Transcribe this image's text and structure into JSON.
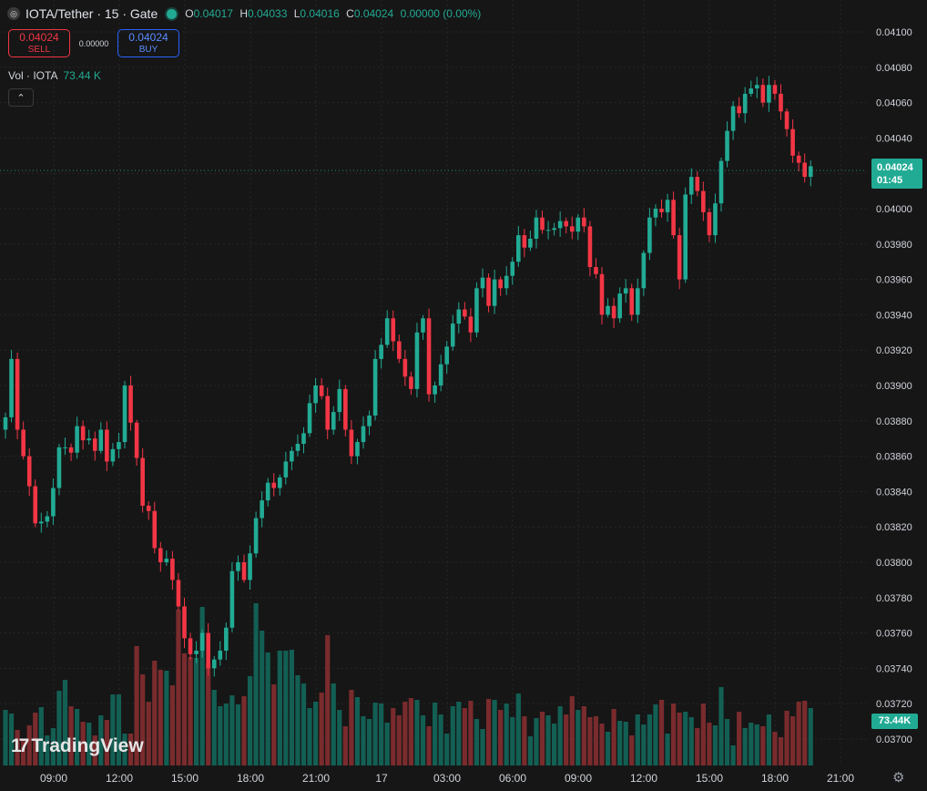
{
  "header": {
    "symbol_title": "IOTA/Tether · 15 · Gate",
    "logo_glyph": "◎",
    "ohlc": {
      "o_label": "O",
      "o": "0.04017",
      "h_label": "H",
      "h": "0.04033",
      "l_label": "L",
      "l": "0.04016",
      "c_label": "C",
      "c": "0.04024",
      "change": "0.00000 (0.00%)"
    }
  },
  "trade": {
    "sell_price": "0.04024",
    "sell_label": "SELL",
    "spread": "0.00000",
    "buy_price": "0.04024",
    "buy_label": "BUY"
  },
  "volume_legend": {
    "label": "Vol · IOTA",
    "value": "73.44 K"
  },
  "collapse_glyph": "⌃",
  "last_price": {
    "price": "0.04024",
    "countdown": "01:45"
  },
  "volume_tag": "73.44K",
  "brand": {
    "logo": "17",
    "name": "TradingView"
  },
  "settings_glyph": "⚙",
  "colors": {
    "up": "#22ab94",
    "down": "#f23645",
    "vol_up": "#135f54",
    "vol_down": "#7a2b2d",
    "background": "#161616"
  },
  "chart_data": {
    "type": "candlestick",
    "y_axis": {
      "min": 0.03695,
      "max": 0.04105,
      "ticks": [
        "0.04100",
        "0.04080",
        "0.04060",
        "0.04040",
        "0.04020",
        "0.04000",
        "0.03980",
        "0.03960",
        "0.03940",
        "0.03920",
        "0.03900",
        "0.03880",
        "0.03860",
        "0.03840",
        "0.03820",
        "0.03800",
        "0.03780",
        "0.03760",
        "0.03740",
        "0.03720",
        "0.03700"
      ]
    },
    "x_axis": {
      "labels": [
        "09:00",
        "12:00",
        "15:00",
        "18:00",
        "21:00",
        "17",
        "03:00",
        "06:00",
        "09:00",
        "12:00",
        "15:00",
        "18:00",
        "21:00"
      ]
    },
    "close": [
      0.03882,
      0.03915,
      0.03875,
      0.0386,
      0.03843,
      0.03822,
      0.03823,
      0.03826,
      0.03842,
      0.03865,
      0.03865,
      0.03862,
      0.03877,
      0.03869,
      0.0387,
      0.03863,
      0.03875,
      0.03857,
      0.03864,
      0.03868,
      0.039,
      0.03879,
      0.03859,
      0.03832,
      0.03829,
      0.03808,
      0.038,
      0.03802,
      0.0379,
      0.03775,
      0.03757,
      0.03748,
      0.0375,
      0.0376,
      0.0374,
      0.03745,
      0.0375,
      0.03763,
      0.03795,
      0.038,
      0.0379,
      0.03805,
      0.03825,
      0.03835,
      0.03845,
      0.03842,
      0.03848,
      0.03857,
      0.03863,
      0.03867,
      0.03873,
      0.0389,
      0.039,
      0.03894,
      0.03875,
      0.03885,
      0.03898,
      0.03875,
      0.0386,
      0.03868,
      0.03877,
      0.03883,
      0.03915,
      0.03923,
      0.03938,
      0.03925,
      0.03915,
      0.03905,
      0.03898,
      0.0393,
      0.03938,
      0.03895,
      0.039,
      0.03912,
      0.03922,
      0.03935,
      0.03943,
      0.03939,
      0.0393,
      0.03955,
      0.03961,
      0.03945,
      0.0396,
      0.03955,
      0.03962,
      0.0397,
      0.03985,
      0.03978,
      0.03983,
      0.03995,
      0.03988,
      0.03988,
      0.03989,
      0.03993,
      0.0399,
      0.03987,
      0.03995,
      0.0399,
      0.03967,
      0.03963,
      0.0394,
      0.03945,
      0.03938,
      0.03952,
      0.03955,
      0.0394,
      0.03955,
      0.03975,
      0.03995,
      0.04,
      0.03998,
      0.04005,
      0.03985,
      0.0396,
      0.04008,
      0.04018,
      0.0401,
      0.03998,
      0.03985,
      0.04003,
      0.04027,
      0.04044,
      0.04058,
      0.04054,
      0.04065,
      0.04068,
      0.0407,
      0.0406,
      0.0407,
      0.04065,
      0.04055,
      0.04045,
      0.0403,
      0.04026,
      0.04018,
      0.04024
    ],
    "volume": [
      61,
      57,
      39,
      27,
      44,
      58,
      64,
      33,
      41,
      82,
      94,
      65,
      62,
      48,
      47,
      33,
      55,
      50,
      78,
      78,
      35,
      35,
      131,
      100,
      70,
      115,
      105,
      104,
      88,
      171,
      123,
      119,
      118,
      174,
      111,
      83,
      65,
      68,
      77,
      67,
      76,
      98,
      178,
      148,
      124,
      89,
      126,
      126,
      127,
      99,
      90,
      63,
      70,
      80,
      143,
      90,
      61,
      43,
      83,
      75,
      54,
      51,
      69,
      68,
      47,
      63,
      55,
      70,
      74,
      72,
      55,
      43,
      69,
      56,
      35,
      65,
      70,
      63,
      71,
      51,
      40,
      73,
      72,
      61,
      68,
      53,
      79,
      54,
      32,
      52,
      59,
      55,
      46,
      65,
      56,
      76,
      61,
      65,
      53,
      54,
      46,
      37,
      62,
      49,
      48,
      33,
      56,
      45,
      56,
      67,
      72,
      35,
      68,
      58,
      59,
      53,
      41,
      68,
      47,
      44,
      86,
      51,
      22,
      59,
      41,
      47,
      45,
      43,
      56,
      37,
      31,
      60,
      54,
      70,
      71,
      63
    ]
  }
}
